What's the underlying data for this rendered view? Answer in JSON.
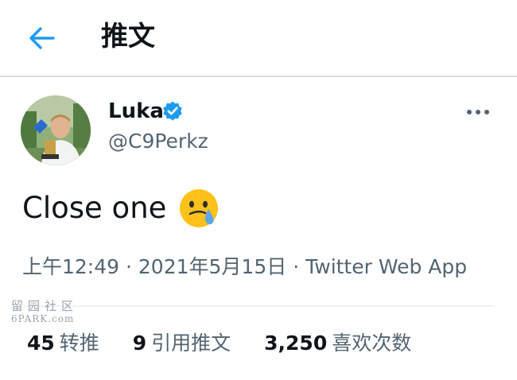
{
  "header": {
    "title": "推文",
    "back_icon": "back-arrow-icon",
    "accent": "#1d9bf0"
  },
  "tweet": {
    "author": {
      "display_name": "Luka",
      "handle": "@C9Perkz",
      "verified": true,
      "verified_icon": "verified-badge-icon"
    },
    "more_icon": "more-dots-icon",
    "text": "Close one",
    "emoji": "crying-face-emoji",
    "time": "上午12:49",
    "separator": "·",
    "date": "2021年5月15日",
    "source": "Twitter Web App"
  },
  "stats": [
    {
      "count": "45",
      "label": "转推"
    },
    {
      "count": "9",
      "label": "引用推文"
    },
    {
      "count": "3,250",
      "label": "喜欢次数"
    }
  ],
  "watermark": {
    "cn": "留园社区",
    "en": "6PARK.com"
  },
  "colors": {
    "text_primary": "#0f1419",
    "text_secondary": "#536471",
    "divider": "#d9dde0",
    "verified": "#1d9bf0"
  }
}
